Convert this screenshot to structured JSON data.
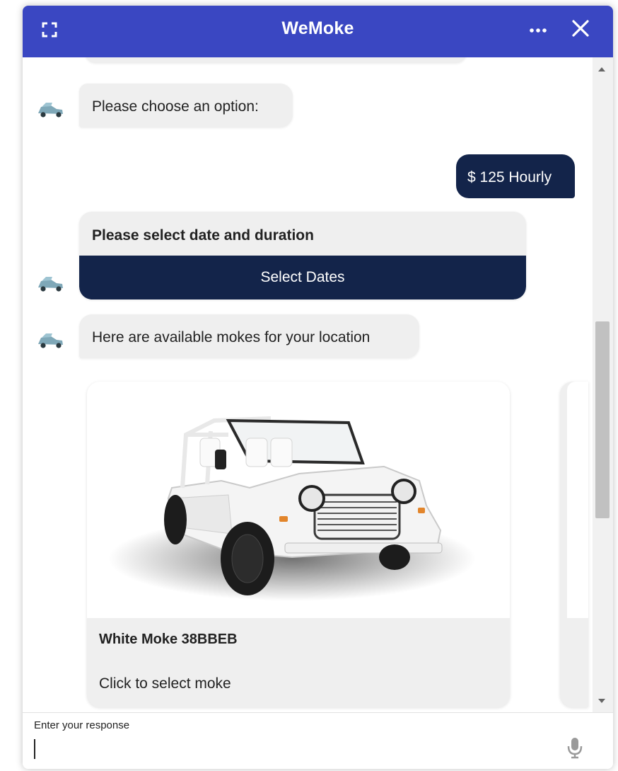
{
  "window": {
    "title": "WeMoke",
    "header_color": "#3a47c2"
  },
  "icons": {
    "expand": "expand-icon",
    "more": "more-horizontal-icon",
    "close": "close-icon",
    "avatar": "moke-car-avatar",
    "mic": "microphone-icon"
  },
  "messages": {
    "bot_choose": "Please choose an option:",
    "user_choice": "$ 125 Hourly",
    "date_prompt": "Please select date and duration",
    "date_button": "Select Dates",
    "available": "Here are available mokes for your location"
  },
  "cards": [
    {
      "name": "White Moke 38BBEB",
      "action": "Click to select moke"
    }
  ],
  "input": {
    "placeholder": "Enter your response",
    "value": ""
  },
  "colors": {
    "accent_dark": "#13244a",
    "bubble_bg": "#efefef"
  }
}
